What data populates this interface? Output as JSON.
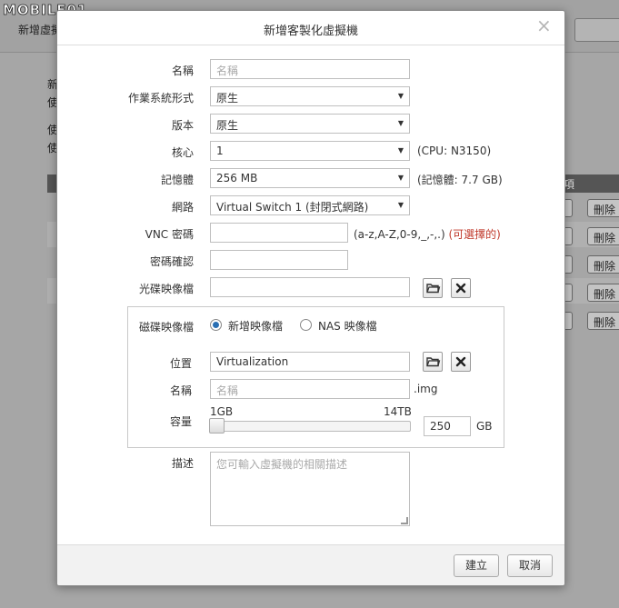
{
  "background": {
    "title": "新增虛擬",
    "text_lines": [
      "新",
      "使",
      "使",
      "使"
    ],
    "column_header": "項",
    "delete_label": "刪除"
  },
  "watermark": {
    "text": "MOBILE01"
  },
  "dialog": {
    "title": "新增客製化虛擬機",
    "close_glyph": "×",
    "fields": {
      "name": {
        "label": "名稱",
        "placeholder": "名稱"
      },
      "os_type": {
        "label": "作業系統形式",
        "value": "原生"
      },
      "version": {
        "label": "版本",
        "value": "原生"
      },
      "cores": {
        "label": "核心",
        "value": "1",
        "hint": "(CPU: N3150)"
      },
      "memory": {
        "label": "記憶體",
        "value": "256 MB",
        "hint": "(記憶體: 7.7 GB)"
      },
      "network": {
        "label": "網路",
        "value": "Virtual Switch 1 (封閉式網路)"
      },
      "vnc_password": {
        "label": "VNC 密碼",
        "hint": "(a-z,A-Z,0-9,_,-,.)",
        "hint_optional": "(可選擇的)"
      },
      "password_confirm": {
        "label": "密碼確認"
      },
      "cd_image": {
        "label": "光碟映像檔"
      }
    },
    "disk": {
      "label": "磁碟映像檔",
      "option_new": "新增映像檔",
      "option_nas": "NAS 映像檔",
      "selected": "新增映像檔",
      "location": {
        "label": "位置",
        "value": "Virtualization"
      },
      "name": {
        "label": "名稱",
        "placeholder": "名稱",
        "suffix": ".img"
      },
      "capacity": {
        "label": "容量",
        "min_label": "1GB",
        "max_label": "14TB",
        "value": "250",
        "unit": "GB",
        "level_fraction": 0.0
      }
    },
    "description": {
      "label": "描述",
      "placeholder": "您可輸入虛擬機的相關描述"
    },
    "buttons": {
      "ok": "建立",
      "cancel": "取消"
    }
  }
}
